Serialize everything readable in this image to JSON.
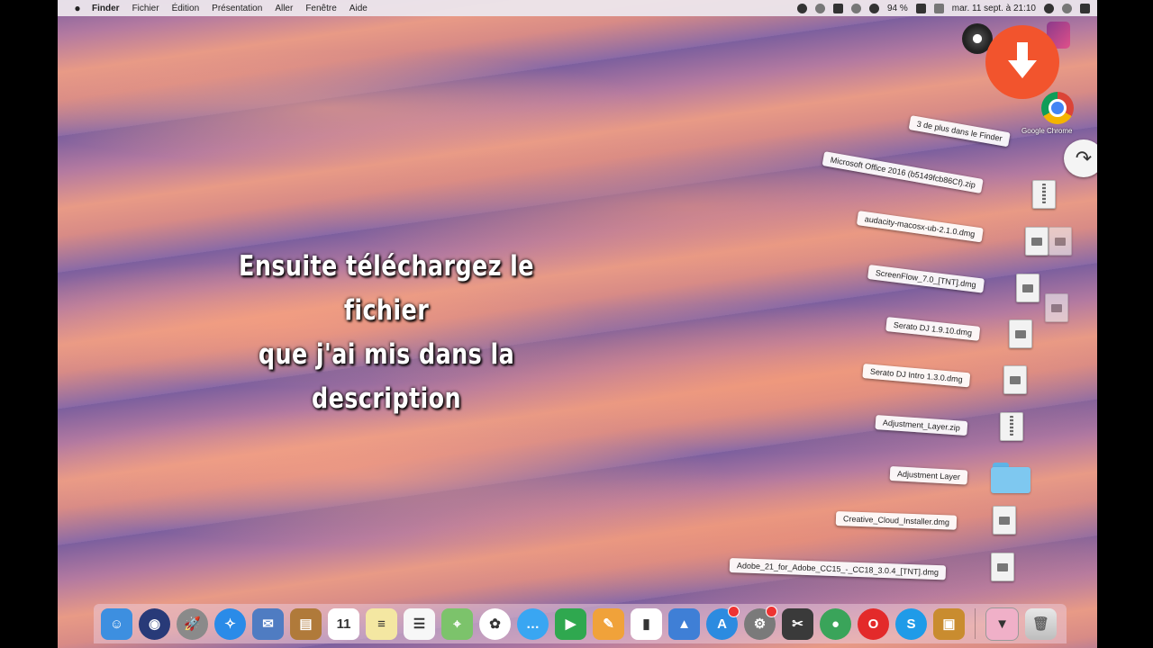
{
  "menubar": {
    "apple": "",
    "items": [
      "Finder",
      "Fichier",
      "Édition",
      "Présentation",
      "Aller",
      "Fenêtre",
      "Aide"
    ],
    "battery": "94 %",
    "clock": "mar. 11 sept. à 21:10"
  },
  "caption": {
    "line1": "Ensuite téléchargez le fichier",
    "line2": "que j'ai mis dans la description"
  },
  "drag_labels": [
    "3 de plus dans le Finder",
    "Microsoft Office 2016 (b5149fcb86Cf).zip",
    "audacity-macosx-ub-2.1.0.dmg",
    "ScreenFlow_7.0_[TNT].dmg",
    "Serato DJ 1.9.10.dmg",
    "Serato DJ Intro 1.3.0.dmg",
    "Adjustment_Layer.zip",
    "Adjustment Layer",
    "Creative_Cloud_Installer.dmg",
    "Adobe_21_for_Adobe_CC15_-_CC18_3.0.4_[TNT].dmg"
  ],
  "desktop_icons": {
    "google_chrome_label": "Google Chrome"
  },
  "colors": {
    "download_button": "#f2542d",
    "menubar": "#ece6ec"
  },
  "dock": {
    "apps": [
      {
        "name": "finder-icon",
        "color": "#3d8fe0",
        "glyph": "☺"
      },
      {
        "name": "siri-icon",
        "color": "#283a78",
        "glyph": "◉"
      },
      {
        "name": "launchpad-icon",
        "color": "#8a8a8a",
        "glyph": "🚀"
      },
      {
        "name": "safari-icon",
        "color": "#2a8be8",
        "glyph": "✧"
      },
      {
        "name": "mail-photo-icon",
        "color": "#4f7cc2",
        "glyph": "✉"
      },
      {
        "name": "notes-book-icon",
        "color": "#b07a3a",
        "glyph": "▤"
      },
      {
        "name": "calendar-icon",
        "color": "#ffffff",
        "glyph": "11"
      },
      {
        "name": "stickies-icon",
        "color": "#f4e7a2",
        "glyph": "≡"
      },
      {
        "name": "reminders-icon",
        "color": "#f7f7f7",
        "glyph": "☰"
      },
      {
        "name": "maps-icon",
        "color": "#7cc36b",
        "glyph": "⌖"
      },
      {
        "name": "photos-icon",
        "color": "#ffffff",
        "glyph": "✿"
      },
      {
        "name": "messages-icon",
        "color": "#39a6f2",
        "glyph": "…"
      },
      {
        "name": "facetime-icon",
        "color": "#2fa84f",
        "glyph": "▶"
      },
      {
        "name": "pages-icon",
        "color": "#f0a23a",
        "glyph": "✎"
      },
      {
        "name": "numbers-icon",
        "color": "#ffffff",
        "glyph": "▮"
      },
      {
        "name": "keynote-icon",
        "color": "#3f7fd6",
        "glyph": "▲"
      },
      {
        "name": "app-store-icon",
        "color": "#2c8be0",
        "glyph": "A",
        "badge": true
      },
      {
        "name": "system-preferences-icon",
        "color": "#7a7a7a",
        "glyph": "⚙",
        "badge": true
      },
      {
        "name": "final-cut-icon",
        "color": "#3a3a3a",
        "glyph": "✂"
      },
      {
        "name": "chrome-icon",
        "color": "#3aa45a",
        "glyph": "●"
      },
      {
        "name": "opera-icon",
        "color": "#e32a2a",
        "glyph": "O"
      },
      {
        "name": "skype-icon",
        "color": "#1f9be8",
        "glyph": "S"
      },
      {
        "name": "archive-utility-icon",
        "color": "#c98c2f",
        "glyph": "▣"
      }
    ]
  }
}
